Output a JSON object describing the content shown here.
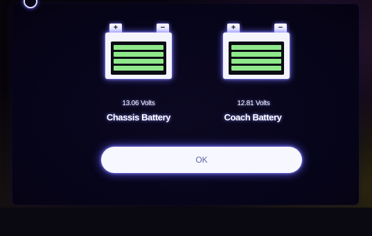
{
  "batteries": [
    {
      "id": "chassis",
      "voltage": "13.06 Volts",
      "label": "Chassis Battery",
      "positive_terminal": "+",
      "negative_terminal": "−",
      "charge_bars_filled": 4,
      "charge_bars_total": 4,
      "bar_color": "#8fe88a"
    },
    {
      "id": "coach",
      "voltage": "12.81 Volts",
      "label": "Coach Battery",
      "positive_terminal": "+",
      "negative_terminal": "−",
      "charge_bars_filled": 4,
      "charge_bars_total": 4,
      "bar_color": "#8fe88a"
    }
  ],
  "ok_button": {
    "label": "OK"
  },
  "colors": {
    "screen_background": "#07051a",
    "glow": "#6d6aff",
    "button_text": "#5b62a8"
  },
  "icons": {
    "corner": "settings-icon"
  }
}
